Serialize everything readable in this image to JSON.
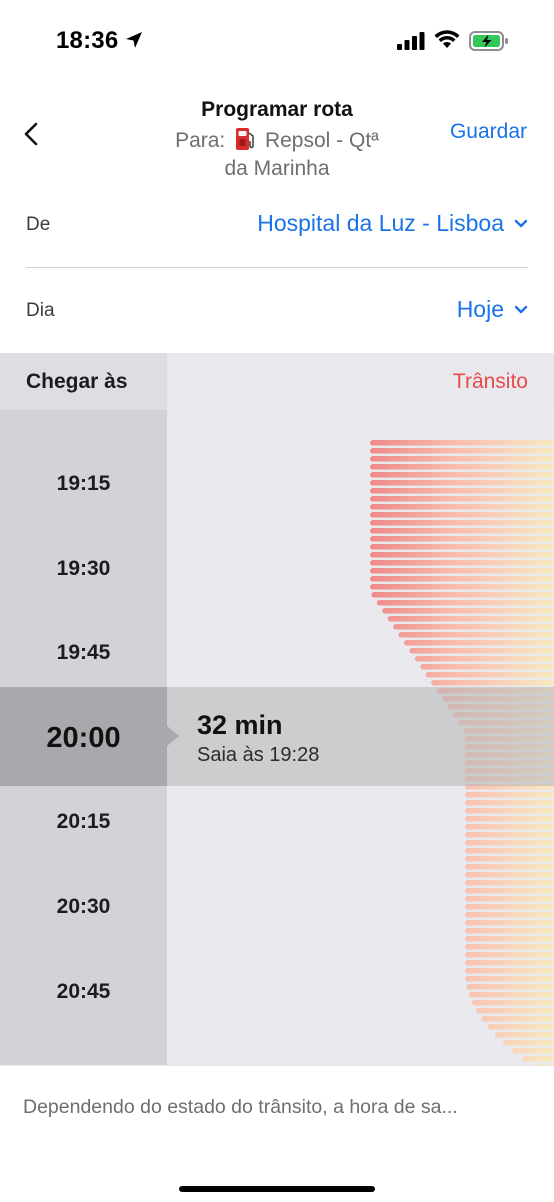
{
  "status_bar": {
    "time": "18:36"
  },
  "nav": {
    "title": "Programar rota",
    "sub_prefix": "Para:",
    "sub_place_line1": "Repsol - Qtª",
    "sub_place_line2": "da Marinha",
    "save_label": "Guardar"
  },
  "from": {
    "label": "De",
    "value": "Hospital da Luz - Lisboa"
  },
  "day": {
    "label": "Dia",
    "value": "Hoje"
  },
  "table": {
    "arrive_label": "Chegar às",
    "traffic_label": "Trânsito",
    "times": [
      "19:15",
      "19:30",
      "19:45",
      "20:15",
      "20:30",
      "20:45"
    ],
    "selected": {
      "time": "20:00",
      "duration": "32 min",
      "leave": "Saia às 19:28"
    }
  },
  "footer": {
    "note": "Dependendo do estado do trânsito, a hora de sa..."
  },
  "colors": {
    "accent": "#1a73e8",
    "traffic": "#e94a4a",
    "bar_red": "#f08a8a",
    "bar_yellow": "#fae8c2"
  },
  "icons": [
    "location-arrow-icon",
    "signal-icon",
    "wifi-icon",
    "battery-charging-icon",
    "back-chevron-icon",
    "fuel-pump-icon",
    "chevron-down-icon"
  ]
}
